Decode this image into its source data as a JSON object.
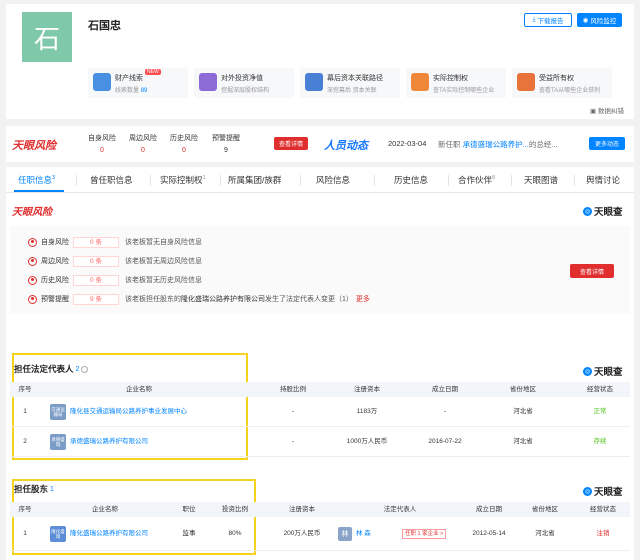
{
  "header": {
    "avatar_char": "石",
    "name": "石国忠",
    "report_btn": "下载报告",
    "monitor_btn": "风险监控",
    "features": [
      {
        "title": "财产线索",
        "badge": "NEW",
        "sub_pre": "线索数量",
        "sub_val": "89",
        "color": "#4a90e2"
      },
      {
        "title": "对外投资净值",
        "sub_pre": "挖掘深层股权结构",
        "sub_val": "",
        "color": "#8c6bd6"
      },
      {
        "title": "幕后资本关联路径",
        "sub_pre": "深挖幕后 资本关联",
        "sub_val": "",
        "color": "#4a7fd6"
      },
      {
        "title": "实际控制权",
        "sub_pre": "查TA实际控制哪些企业",
        "sub_val": "",
        "color": "#f0883a"
      },
      {
        "title": "受益所有权",
        "sub_pre": "查看TA从哪些企业获利",
        "sub_val": "",
        "color": "#e8743b"
      }
    ],
    "feedback": "数据纠错"
  },
  "strip": {
    "brand_left": "天眼风险",
    "cols": [
      {
        "label": "自身风险",
        "value": "0"
      },
      {
        "label": "周边风险",
        "value": "0"
      },
      {
        "label": "历史风险",
        "value": "0"
      },
      {
        "label": "预警提醒",
        "value": "9"
      }
    ],
    "detail_btn": "查看详情",
    "brand_right": "人员动态",
    "date": "2022-03-04",
    "news_pre": "新任职",
    "news_link": "承德盛瑞公路养护...",
    "news_post": "的总经...",
    "more_btn": "更多动态"
  },
  "tabs": [
    {
      "label": "任职信息",
      "count": "3",
      "active": true
    },
    {
      "label": "曾任职信息",
      "count": ""
    },
    {
      "label": "实际控制权",
      "count": "1"
    },
    {
      "label": "所属集团/族群",
      "count": ""
    },
    {
      "label": "风险信息",
      "count": ""
    },
    {
      "label": "历史信息",
      "count": ""
    },
    {
      "label": "合作伙伴",
      "count": "8"
    },
    {
      "label": "天眼图谱",
      "count": ""
    },
    {
      "label": "舆情讨论",
      "count": ""
    }
  ],
  "risk": {
    "title": "天眼风险",
    "tyc_logo": "天眼查",
    "rows": [
      {
        "label": "自身风险",
        "count": "0 条",
        "desc": "该老板暂无自身风险信息"
      },
      {
        "label": "周边风险",
        "count": "0 条",
        "desc": "该老板暂无周边风险信息"
      },
      {
        "label": "历史风险",
        "count": "0 条",
        "desc": "该老板暂无历史风险信息"
      },
      {
        "label": "预警提醒",
        "count": "9 条",
        "desc_pre": "该老板担任股东的",
        "desc_co": "隆化盛瑞公路养护有限公司",
        "desc_post": "发生了法定代表人变更（1）",
        "more": "更多"
      }
    ],
    "detail_btn": "查看详情"
  },
  "legal_rep": {
    "title": "担任法定代表人",
    "count": "2",
    "headers": [
      "序号",
      "企业名称",
      "持股比例",
      "注册资本",
      "成立日期",
      "省份地区",
      "经营状态"
    ],
    "rows": [
      {
        "no": "1",
        "logo": "交通运输局",
        "logo_color": "#7a9cc6",
        "name": "隆化县交通运输局公路养护事业发展中心",
        "share": "-",
        "capital": "1183万",
        "date": "-",
        "region": "河北省",
        "status": "正常",
        "status_type": "green"
      },
      {
        "no": "2",
        "logo": "承德盛瑞",
        "logo_color": "#7a9cc6",
        "name": "承德盛瑞公路养护有限公司",
        "share": "-",
        "capital": "1000万人民币",
        "date": "2016-07-22",
        "region": "河北省",
        "status": "存续",
        "status_type": "green"
      }
    ]
  },
  "shareholder": {
    "title": "担任股东",
    "count": "1",
    "headers": [
      "序号",
      "企业名称",
      "职位",
      "投资比例",
      "注册资本",
      "法定代表人",
      "成立日期",
      "省份地区",
      "经营状态"
    ],
    "rows": [
      {
        "no": "1",
        "logo": "隆化盛瑞",
        "logo_color": "#5b8ed6",
        "name": "隆化盛瑞公路养护有限公司",
        "position": "监事",
        "ratio": "80%",
        "capital": "200万人民币",
        "rep_char": "林",
        "rep_name": "林 森",
        "rep_tag": "任职 1 家企业 >",
        "date": "2012-05-14",
        "region": "河北省",
        "status": "注销",
        "status_type": "red"
      }
    ]
  }
}
